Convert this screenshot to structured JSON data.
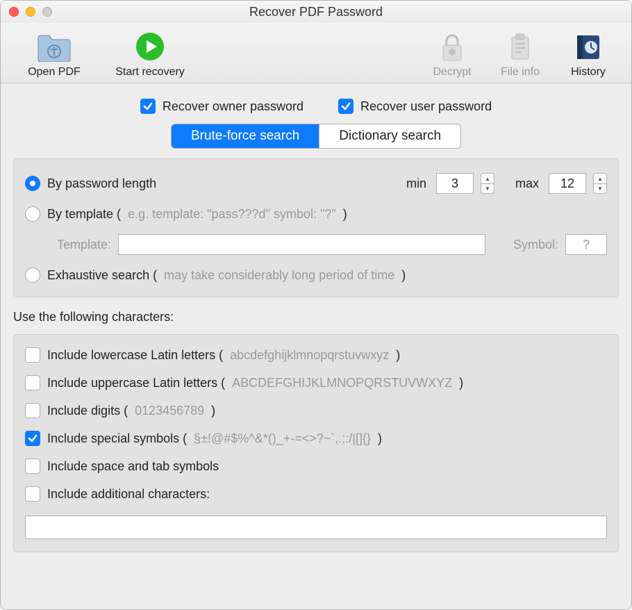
{
  "window": {
    "title": "Recover PDF Password"
  },
  "toolbar": {
    "open_pdf": "Open PDF",
    "start_recovery": "Start recovery",
    "decrypt": "Decrypt",
    "file_info": "File info",
    "history": "History"
  },
  "top": {
    "recover_owner": "Recover owner password",
    "recover_user": "Recover user password",
    "owner_checked": true,
    "user_checked": true
  },
  "tabs": {
    "brute": "Brute-force search",
    "dict": "Dictionary search",
    "active": "brute"
  },
  "method": {
    "by_length": "By password length",
    "min_label": "min",
    "min_value": "3",
    "max_label": "max",
    "max_value": "12",
    "by_template": "By template (",
    "by_template_hint": " e.g. template: \"pass???d\" symbol: \"?\" ",
    "close_paren": ")",
    "template_label": "Template:",
    "template_value": "",
    "symbol_label": "Symbol:",
    "symbol_value": "?",
    "exhaustive": "Exhaustive search (",
    "exhaustive_hint": " may take considerably long period of time ",
    "selected": "length"
  },
  "chars": {
    "heading": "Use the following characters:",
    "lower": "Include lowercase Latin letters (",
    "lower_hint": "abcdefghijklmnopqrstuvwxyz",
    "upper": "Include uppercase Latin letters (",
    "upper_hint": "ABCDEFGHIJKLMNOPQRSTUVWXYZ",
    "digits": "Include digits (",
    "digits_hint": "0123456789",
    "symbols": "Include special symbols (",
    "symbols_hint": "§±!@#$%^&*()_+-=<>?~`,.;:/|[]{}",
    "space": "Include space and tab symbols",
    "additional": "Include additional characters:",
    "additional_value": "",
    "lower_checked": false,
    "upper_checked": false,
    "digits_checked": false,
    "symbols_checked": true,
    "space_checked": false,
    "additional_checked": false
  }
}
